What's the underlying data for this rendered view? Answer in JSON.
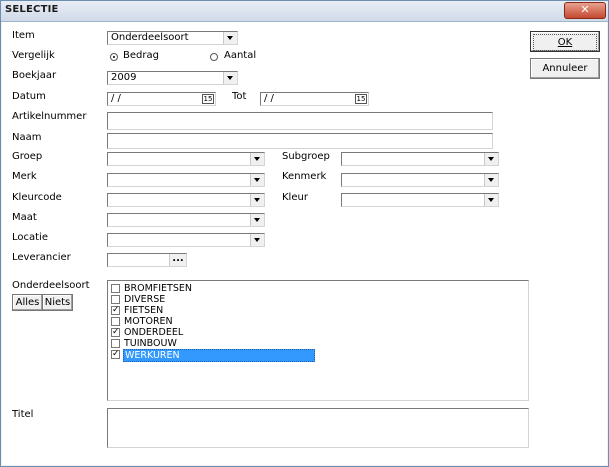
{
  "window": {
    "title": "SELECTIE",
    "close_glyph": "✕"
  },
  "labels": {
    "item": "Item",
    "vergelijk": "Vergelijk",
    "boekjaar": "Boekjaar",
    "datum": "Datum",
    "tot": "Tot",
    "artikelnummer": "Artikelnummer",
    "naam": "Naam",
    "groep": "Groep",
    "subgroep": "Subgroep",
    "merk": "Merk",
    "kenmerk": "Kenmerk",
    "kleurcode": "Kleurcode",
    "kleur": "Kleur",
    "maat": "Maat",
    "locatie": "Locatie",
    "leverancier": "Leverancier",
    "onderdeelsoort": "Onderdeelsoort",
    "titel": "Titel"
  },
  "fields": {
    "item_value": "Onderdeelsoort",
    "boekjaar_value": "2009",
    "datum_value": " / /",
    "tot_value": " / /",
    "artikelnummer_value": "",
    "naam_value": "",
    "groep_value": "",
    "subgroep_value": "",
    "merk_value": "",
    "kenmerk_value": "",
    "kleurcode_value": "",
    "kleur_value": "",
    "maat_value": "",
    "locatie_value": "",
    "leverancier_value": "",
    "titel_value": ""
  },
  "vergelijk_options": [
    {
      "label": "Bedrag",
      "selected": true
    },
    {
      "label": "Aantal",
      "selected": false
    }
  ],
  "calendar_icon_text": "15",
  "leverancier_button": "...",
  "buttons": {
    "ok": "OK",
    "annuleer": "Annuleer",
    "alles": "Alles",
    "niets": "Niets"
  },
  "onderdeelsoort_list": [
    {
      "label": "BROMFIETSEN",
      "checked": false,
      "selected": false
    },
    {
      "label": "DIVERSE",
      "checked": false,
      "selected": false
    },
    {
      "label": "FIETSEN",
      "checked": true,
      "selected": false
    },
    {
      "label": "MOTOREN",
      "checked": false,
      "selected": false
    },
    {
      "label": "ONDERDEEL",
      "checked": true,
      "selected": false
    },
    {
      "label": "TUINBOUW",
      "checked": false,
      "selected": false
    },
    {
      "label": "WERKUREN",
      "checked": true,
      "selected": true
    }
  ]
}
